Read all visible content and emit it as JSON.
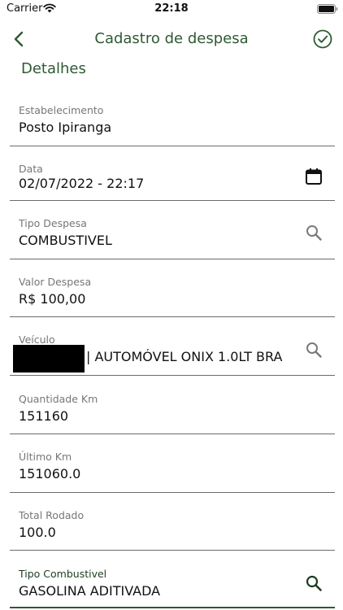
{
  "status_bar": {
    "carrier": "Carrier",
    "time": "22:18",
    "icons": [
      "wifi-icon",
      "battery-icon"
    ]
  },
  "header": {
    "title": "Cadastro de despesa",
    "back_icon": "chevron-left-icon",
    "confirm_icon": "check-circle-icon"
  },
  "section": {
    "title": "Detalhes"
  },
  "fields": {
    "estabelecimento": {
      "label": "Estabelecimento",
      "value": "Posto Ipiranga"
    },
    "data": {
      "label": "Data",
      "value": "02/07/2022 - 22:17",
      "icon": "calendar-icon"
    },
    "tipo_despesa": {
      "label": "Tipo Despesa",
      "value": "COMBUSTIVEL",
      "icon": "search-icon"
    },
    "valor_despesa": {
      "label": "Valor Despesa",
      "value": "R$ 100,00"
    },
    "veiculo": {
      "label": "Veículo",
      "value": "| AUTOMÓVEL ONIX 1.0LT BRA",
      "icon": "search-icon"
    },
    "quantidade_km": {
      "label": "Quantidade Km",
      "value": "151160"
    },
    "ultimo_km": {
      "label": "Último Km",
      "value": "151060.0"
    },
    "total_rodado": {
      "label": "Total Rodado",
      "value": "100.0"
    },
    "tipo_combustivel": {
      "label": "Tipo Combustivel",
      "value": "GASOLINA ADITIVADA",
      "icon": "search-icon"
    }
  },
  "colors": {
    "accent": "#2e5a33",
    "label": "#777777",
    "divider": "#6b6b6b"
  }
}
